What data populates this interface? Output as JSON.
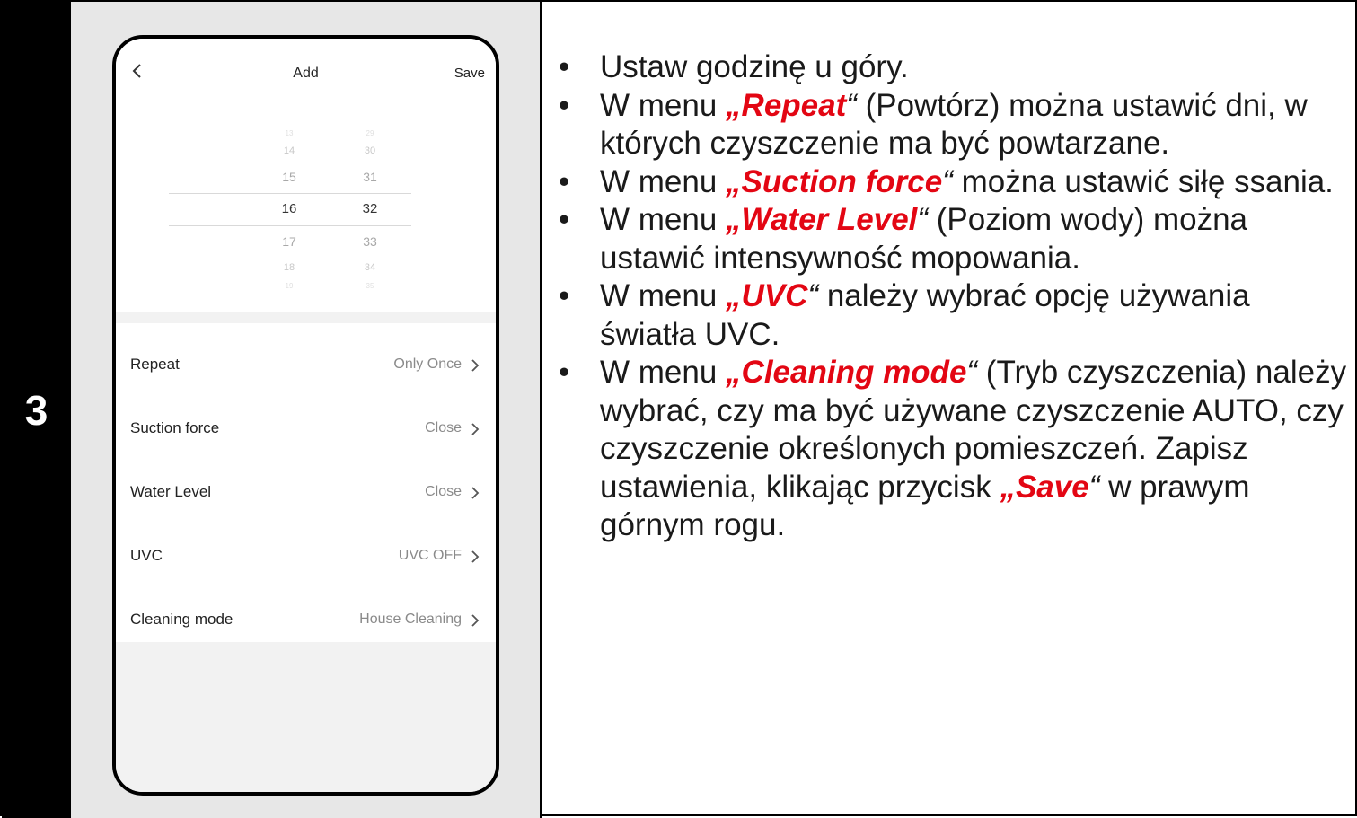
{
  "step_number": "3",
  "phone": {
    "title": "Add",
    "save_label": "Save",
    "picker": {
      "hours": [
        "13",
        "14",
        "15",
        "16",
        "17",
        "18",
        "19"
      ],
      "minutes": [
        "29",
        "30",
        "31",
        "32",
        "33",
        "34",
        "35"
      ],
      "selected_hour": "16",
      "selected_minute": "32"
    },
    "rows": [
      {
        "label": "Repeat",
        "value": "Only Once"
      },
      {
        "label": "Suction force",
        "value": "Close"
      },
      {
        "label": "Water Level",
        "value": "Close"
      },
      {
        "label": "UVC",
        "value": "UVC OFF"
      },
      {
        "label": "Cleaning mode",
        "value": "House Cleaning"
      }
    ]
  },
  "instructions": {
    "b1": "Ustaw godzinę u góry.",
    "b2_pre": "W menu ",
    "b2_kw": "Repeat",
    "b2_post": " (Powtórz) można ustawić dni, w których czyszczenie ma być powtarzane.",
    "b3_pre": "W menu ",
    "b3_kw": "Suction force",
    "b3_post": " można ustawić siłę ssania.",
    "b4_pre": "W menu ",
    "b4_kw": "Water Level",
    "b4_post": " (Poziom wody) można ustawić intensywność mopowania.",
    "b5_pre": "W menu ",
    "b5_kw": "UVC",
    "b5_post": " należy wybrać opcję używania światła UVC.",
    "b6_pre": "W menu ",
    "b6_kw": "Cleaning mode",
    "b6_post": " (Tryb czyszczenia) należy wybrać, czy ma być używane czyszczenie AUTO, czy czyszczenie określonych pomieszczeń. Zapisz ustawienia, klikając przycisk ",
    "b6_kw2": "Save",
    "b6_end": " w prawym górnym rogu.",
    "open_quote": "„",
    "close_quote": "“",
    "bullet_char": "•"
  },
  "colors": {
    "keyword": "#e30613",
    "panel_bg": "#e7e7e7"
  }
}
